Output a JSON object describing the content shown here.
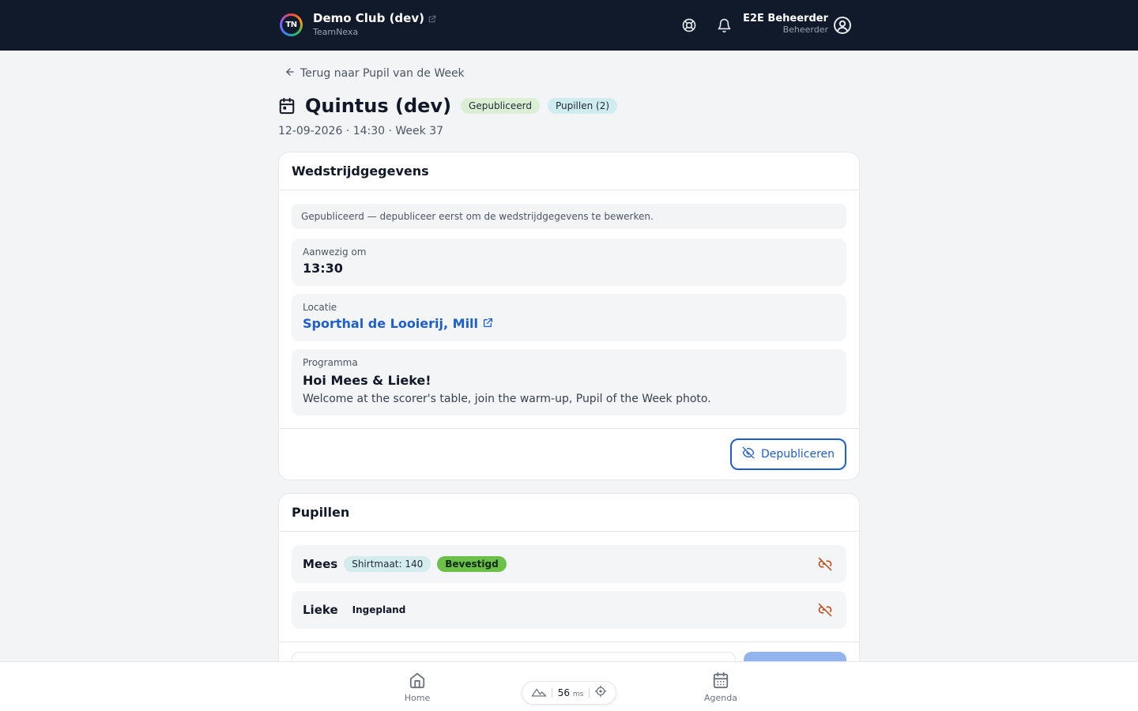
{
  "header": {
    "club_name": "Demo Club (dev)",
    "org_name": "TeamNexa",
    "logo_text": "TN",
    "user_name": "E2E Beheerder",
    "user_role": "Beheerder"
  },
  "page": {
    "back_label": "Terug naar Pupil van de Week",
    "title": "Quintus (dev)",
    "status_badge": "Gepubliceerd",
    "pupils_badge": "Pupillen (2)",
    "subline": "12-09-2026 · 14:30 · Week 37"
  },
  "match_card": {
    "title": "Wedstrijdgegevens",
    "notice": "Gepubliceerd — depubliceer eerst om de wedstrijdgegevens te bewerken.",
    "present_label": "Aanwezig om",
    "present_value": "13:30",
    "location_label": "Locatie",
    "location_value": "Sporthal de Looierij, Mill",
    "program_label": "Programma",
    "program_title": "Hoi Mees & Lieke!",
    "program_text": "Welcome at the scorer's table, join the warm-up, Pupil of the Week photo.",
    "unpublish_label": "Depubliceren"
  },
  "pupils_card": {
    "title": "Pupillen",
    "pupils": [
      {
        "name": "Mees",
        "shirt": "Shirtmaat: 140",
        "status": "Bevestigd"
      },
      {
        "name": "Lieke",
        "status": "Ingepland"
      }
    ]
  },
  "bottom_nav": {
    "home_label": "Home",
    "agenda_label": "Agenda",
    "latency_value": "56",
    "latency_unit": "ms"
  },
  "colors": {
    "topbar": "#101a2b",
    "accent": "#1d5fd0",
    "confirmed": "#6cc04a",
    "unlink": "#c2410c"
  }
}
